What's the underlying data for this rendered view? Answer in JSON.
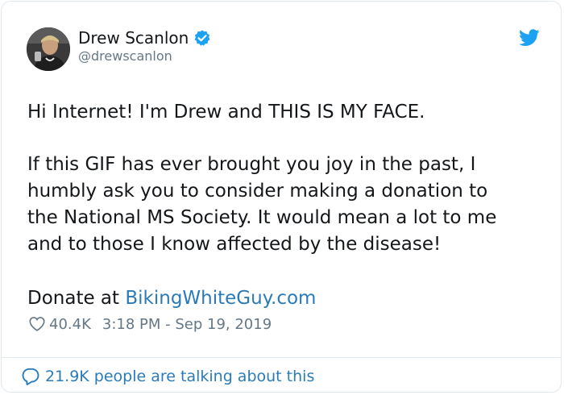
{
  "author": {
    "display_name": "Drew Scanlon",
    "handle": "@drewscanlon",
    "verified": true
  },
  "tweet": {
    "line_1": "Hi Internet! I'm Drew and THIS IS MY FACE.",
    "paragraph_2": [
      "If this GIF has ever brought you joy in the past, I",
      "humbly ask you to consider making a donation to",
      "the National MS Society. It would mean a lot to me",
      "and to those I know affected by the disease!"
    ],
    "donate_prefix": "Donate at ",
    "donate_link": "BikingWhiteGuy.com"
  },
  "meta": {
    "like_count": "40.4K",
    "timestamp": "3:18 PM - Sep 19, 2019"
  },
  "footer": {
    "talking_text": "21.9K people are talking about this"
  },
  "colors": {
    "link": "#2b7bb9",
    "twitter_blue": "#1da1f2",
    "secondary_text": "#657786",
    "border": "#e1e8ed"
  },
  "icons": {
    "avatar": "avatar",
    "verified": "verified-badge-icon",
    "brand": "twitter-bird-icon",
    "like": "heart-icon",
    "reply": "speech-bubble-icon"
  }
}
